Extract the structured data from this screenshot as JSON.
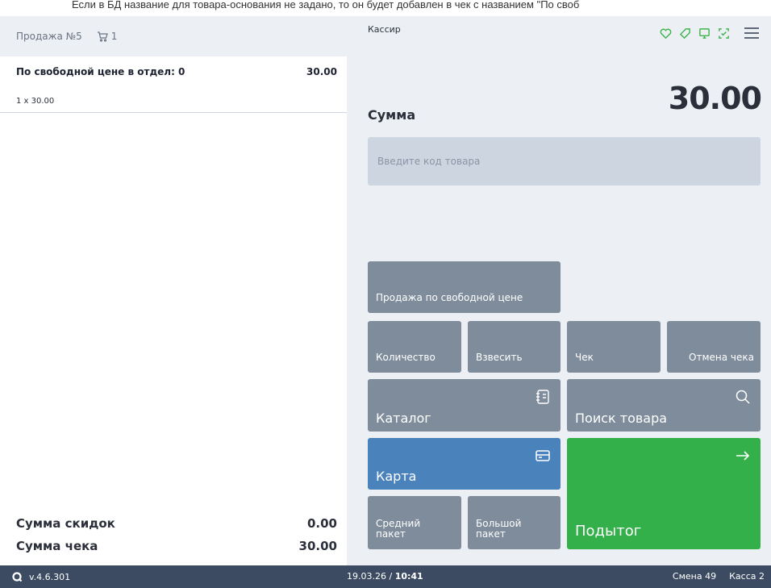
{
  "banner": {
    "text": "Если в БД название для товара-основания не задано, то он будет добавлен в чек с названием \"По своб"
  },
  "receipt": {
    "title": "Продажа №5",
    "cart_count": "1",
    "items": [
      {
        "name": "По свободной цене в отдел: 0",
        "price": "30.00",
        "qty_line": "1 x 30.00"
      }
    ],
    "totals": [
      {
        "label": "Сумма скидок",
        "value": "0.00"
      },
      {
        "label": "Сумма чека",
        "value": "30.00"
      }
    ]
  },
  "header": {
    "cashier": "Кассир",
    "icons": [
      "heart-icon",
      "tag-icon",
      "monitor-icon",
      "scan-icon",
      "menu-icon"
    ]
  },
  "sum": {
    "label": "Сумма",
    "value": "30.00"
  },
  "code_input": {
    "placeholder": "Введите код товара"
  },
  "buttons": {
    "free_price": "Продажа по свободной цене",
    "quantity": "Количество",
    "weigh": "Взвесить",
    "receipt": "Чек",
    "cancel_receipt": "Отмена чека",
    "catalog": "Каталог",
    "search": "Поиск товара",
    "card": "Карта",
    "medium_bag": "Средний пакет",
    "large_bag": "Большой пакет",
    "subtotal": "Подытог"
  },
  "colors": {
    "accent_green": "#33b04a",
    "card_blue": "#4a82bc",
    "button_gray": "#7f8c9b",
    "status_bar": "#3c4b61"
  },
  "status": {
    "version": "v.4.6.301",
    "date": "19.03.26 / ",
    "time": "10:41",
    "shift": "Смена 49",
    "register": "Касса 2"
  }
}
